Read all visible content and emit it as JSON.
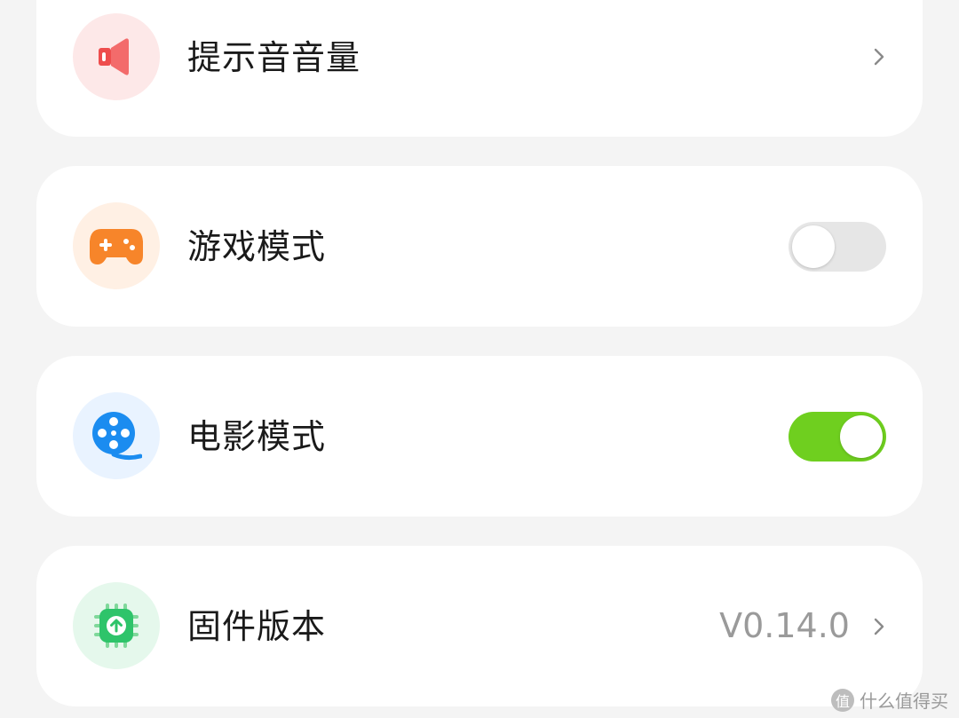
{
  "settings": [
    {
      "label": "提示音音量",
      "icon": "speaker-icon",
      "icon_bg": "#fde8e8",
      "control": "chevron"
    },
    {
      "label": "游戏模式",
      "icon": "gamepad-icon",
      "icon_bg": "#fff0e4",
      "control": "toggle",
      "state": "off"
    },
    {
      "label": "电影模式",
      "icon": "film-reel-icon",
      "icon_bg": "#e9f3ff",
      "control": "toggle",
      "state": "on"
    },
    {
      "label": "固件版本",
      "icon": "firmware-upgrade-icon",
      "icon_bg": "#e5f8ec",
      "control": "chevron",
      "value": "V0.14.0"
    }
  ],
  "colors": {
    "toggle_on": "#6fcf1f",
    "toggle_off": "#e6e6e6",
    "background": "#f4f4f4"
  },
  "watermark": {
    "badge": "值",
    "text": "什么值得买"
  }
}
